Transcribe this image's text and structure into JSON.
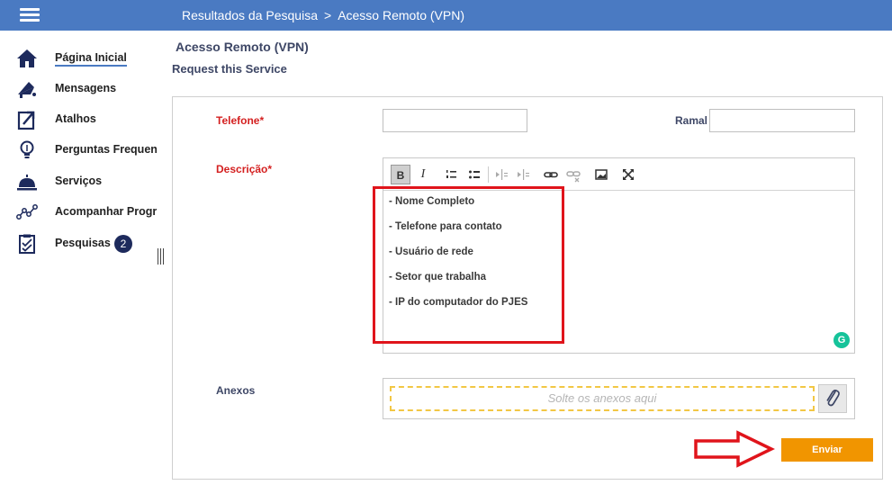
{
  "breadcrumb": {
    "parent": "Resultados da Pesquisa",
    "separator": ">",
    "current": "Acesso Remoto (VPN)"
  },
  "sidebar": {
    "items": [
      {
        "label": "Página Inicial",
        "icon": "home-icon"
      },
      {
        "label": "Mensagens",
        "icon": "megaphone-icon"
      },
      {
        "label": "Atalhos",
        "icon": "shortcut-icon"
      },
      {
        "label": "Perguntas Frequentes",
        "icon": "lightbulb-icon"
      },
      {
        "label": "Serviços",
        "icon": "service-bell-icon"
      },
      {
        "label": "Acompanhar Progresso",
        "icon": "progress-icon"
      },
      {
        "label": "Pesquisas",
        "icon": "clipboard-icon",
        "badge": "2"
      }
    ]
  },
  "page": {
    "title": "Acesso Remoto (VPN)",
    "subtitle": "Request this Service"
  },
  "form": {
    "telefone_label": "Telefone",
    "required_mark": "*",
    "telefone_value": "",
    "ramal_label": "Ramal",
    "ramal_value": "",
    "descricao_label": "Descrição",
    "descricao_lines": [
      "- Nome Completo",
      "- Telefone para contato",
      "- Usuário de rede",
      "- Setor que trabalha",
      "- IP do computador do PJES"
    ],
    "anexos_label": "Anexos",
    "dropzone_text": "Solte os anexos aqui",
    "submit_label": "Enviar"
  },
  "editor_toolbar": {
    "bold": "B",
    "italic": "I",
    "buttons": [
      "bold",
      "italic",
      "ordered-list",
      "bullet-list",
      "outdent",
      "indent",
      "link",
      "unlink",
      "image",
      "fullscreen"
    ]
  },
  "grammarly": "G",
  "colors": {
    "topbar": "#4a7ac2",
    "required": "#d42020",
    "submit": "#f19500",
    "annotation": "#e0141b",
    "badge": "#1d2a5c"
  }
}
